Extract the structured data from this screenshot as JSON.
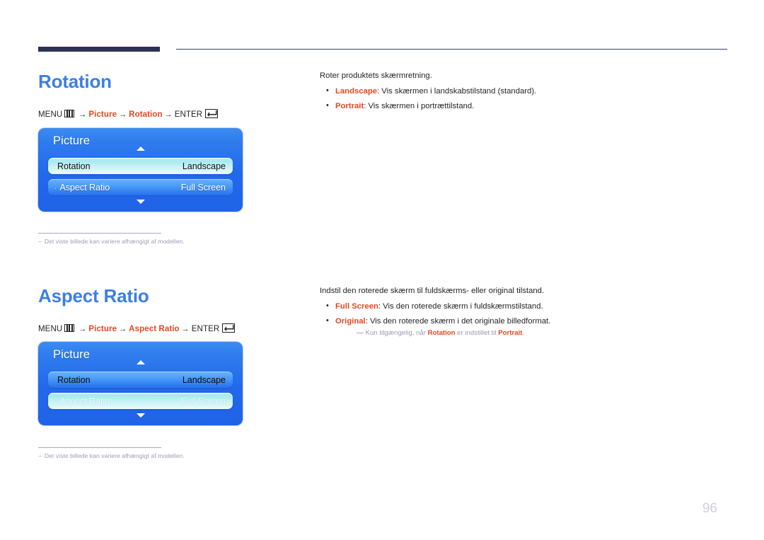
{
  "page": {
    "number": "96"
  },
  "sections": [
    {
      "heading": "Rotation",
      "menu_path": {
        "menu_label": "MENU",
        "menu_icon": "menu-bars-icon",
        "arrow": "→",
        "step1": "Picture",
        "step2": "Rotation",
        "enter_label": "ENTER",
        "enter_icon": "enter-key-icon"
      },
      "osd": {
        "title": "Picture",
        "up_arrow_icon": "chevron-up-icon",
        "down_arrow_icon": "chevron-down-icon",
        "rows": [
          {
            "label": "Rotation",
            "value": "Landscape",
            "state": "selected",
            "dot": ""
          },
          {
            "label": "Aspect Ratio",
            "value": "Full Screen",
            "state": "normal",
            "dot": "·"
          }
        ]
      },
      "footnote": {
        "dash": "–",
        "text": "Det viste billede kan variere afhængigt af modellen."
      },
      "body": {
        "intro": "Roter produktets skærmretning.",
        "bullets": [
          {
            "bullet": "•",
            "term": "Landscape",
            "text": ": Vis skærmen i landskabstilstand (standard)."
          },
          {
            "bullet": "•",
            "term": "Portrait",
            "text": ": Vis skærmen i portrættilstand."
          }
        ]
      }
    },
    {
      "heading": "Aspect Ratio",
      "menu_path": {
        "menu_label": "MENU",
        "menu_icon": "menu-bars-icon",
        "arrow": "→",
        "step1": "Picture",
        "step2": "Aspect Ratio",
        "enter_label": "ENTER",
        "enter_icon": "enter-key-icon"
      },
      "osd": {
        "title": "Picture",
        "up_arrow_icon": "chevron-up-icon",
        "down_arrow_icon": "chevron-down-icon",
        "rows": [
          {
            "label": "Rotation",
            "value": "Landscape",
            "state": "normal-dark",
            "dot": ""
          },
          {
            "label": "Aspect Ratio",
            "value": "Full Screen",
            "state": "selected-light",
            "dot": "·"
          }
        ]
      },
      "footnote": {
        "dash": "–",
        "text": "Det viste billede kan variere afhængigt af modellen."
      },
      "body": {
        "intro": "Indstil den roterede skærm til fuldskærms- eller original tilstand.",
        "bullets": [
          {
            "bullet": "•",
            "term": "Full Screen",
            "text": ": Vis den roterede skærm i fuldskærmstilstand."
          },
          {
            "bullet": "•",
            "term": "Original",
            "text": ": Vis den roterede skærm i det originale billedformat."
          }
        ],
        "subnote": {
          "dash": "—",
          "pre": "Kun tilgængelig, når ",
          "term1": "Rotation",
          "mid": " er indstillet til ",
          "term2": "Portrait",
          "post": "."
        }
      }
    }
  ],
  "colors": {
    "heading_blue": "#3d7fe0",
    "term_red": "#e8461e",
    "rule_navy": "#2e3054",
    "osd_blue": "#2269ea",
    "osd_selected_cyan": "#bfeef6",
    "footnote_gray": "#9d9cb6"
  }
}
